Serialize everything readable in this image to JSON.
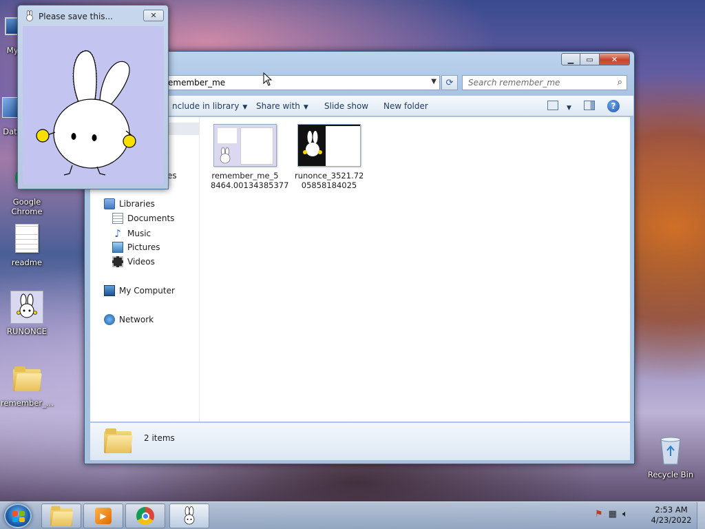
{
  "desktop": {
    "icons": [
      {
        "label": "My C",
        "icon": "computer-icon"
      },
      {
        "label": "Data",
        "icon": "data-icon"
      },
      {
        "label": "Google Chrome",
        "icon": "chrome-icon"
      },
      {
        "label": "readme",
        "icon": "document-icon"
      },
      {
        "label": "RUNONCE",
        "icon": "bunny-icon"
      },
      {
        "label": "remember_...",
        "icon": "folder-icon"
      }
    ],
    "recycle_bin": "Recycle Bin"
  },
  "popup": {
    "title": "Please save this...",
    "close_glyph": "✕"
  },
  "explorer": {
    "address": "emember_me",
    "search_placeholder": "Search remember_me",
    "window_buttons": {
      "minimize": "▁",
      "maximize": "▭",
      "close": "✕"
    },
    "toolbar": {
      "include_in_library": "nclude in library",
      "share_with": "Share with",
      "slide_show": "Slide show",
      "new_folder": "New folder",
      "help": "?"
    },
    "nav": {
      "partial_label": "es",
      "libraries": "Libraries",
      "documents": "Documents",
      "music": "Music",
      "pictures": "Pictures",
      "videos": "Videos",
      "my_computer": "My Computer",
      "network": "Network"
    },
    "files": [
      {
        "name_line1": "remember_me_5",
        "name_line2": "8464.00134385377"
      },
      {
        "name_line1": "runonce_3521.72",
        "name_line2": "05858184025"
      }
    ],
    "status": "2 items"
  },
  "taskbar": {
    "time": "2:53 AM",
    "date": "4/23/2022"
  },
  "colors": {
    "accent": "#1f58ad",
    "popup_body": "#c4c4f1",
    "close_red": "#c7442b",
    "folder_yellow": "#e8c058"
  }
}
